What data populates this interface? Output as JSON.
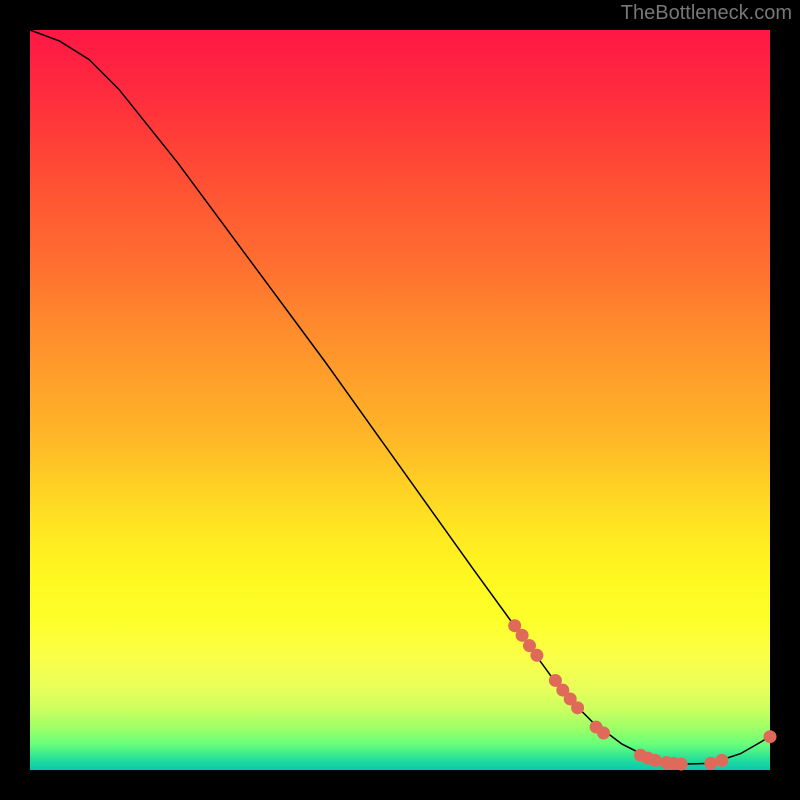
{
  "watermark": "TheBottleneck.com",
  "chart_data": {
    "type": "line",
    "title": "",
    "xlabel": "",
    "ylabel": "",
    "xlim": [
      0,
      100
    ],
    "ylim": [
      0,
      100
    ],
    "background": "rainbow-gradient-vertical",
    "series": [
      {
        "name": "bottleneck-curve",
        "color": "#000000",
        "points": [
          {
            "x": 0,
            "y": 100
          },
          {
            "x": 4,
            "y": 98.5
          },
          {
            "x": 8,
            "y": 96
          },
          {
            "x": 12,
            "y": 92
          },
          {
            "x": 20,
            "y": 82
          },
          {
            "x": 30,
            "y": 68.5
          },
          {
            "x": 40,
            "y": 55
          },
          {
            "x": 50,
            "y": 41
          },
          {
            "x": 60,
            "y": 27
          },
          {
            "x": 68,
            "y": 16
          },
          {
            "x": 72,
            "y": 10.5
          },
          {
            "x": 76,
            "y": 6.5
          },
          {
            "x": 80,
            "y": 3.5
          },
          {
            "x": 84,
            "y": 1.5
          },
          {
            "x": 88,
            "y": 0.8
          },
          {
            "x": 92,
            "y": 0.9
          },
          {
            "x": 96,
            "y": 2.2
          },
          {
            "x": 100,
            "y": 4.5
          }
        ]
      }
    ],
    "dots": [
      {
        "x": 65.5,
        "y": 19.5
      },
      {
        "x": 66.5,
        "y": 18.2
      },
      {
        "x": 67.5,
        "y": 16.8
      },
      {
        "x": 68.5,
        "y": 15.5
      },
      {
        "x": 71.0,
        "y": 12.1
      },
      {
        "x": 72.0,
        "y": 10.8
      },
      {
        "x": 73.0,
        "y": 9.6
      },
      {
        "x": 74.0,
        "y": 8.4
      },
      {
        "x": 76.5,
        "y": 5.8
      },
      {
        "x": 77.5,
        "y": 5.0
      },
      {
        "x": 82.5,
        "y": 2.0
      },
      {
        "x": 83.5,
        "y": 1.6
      },
      {
        "x": 84.5,
        "y": 1.3
      },
      {
        "x": 86.0,
        "y": 1.0
      },
      {
        "x": 87.0,
        "y": 0.9
      },
      {
        "x": 88.0,
        "y": 0.8
      },
      {
        "x": 92.0,
        "y": 0.9
      },
      {
        "x": 93.5,
        "y": 1.3
      },
      {
        "x": 100.0,
        "y": 4.5
      }
    ]
  }
}
